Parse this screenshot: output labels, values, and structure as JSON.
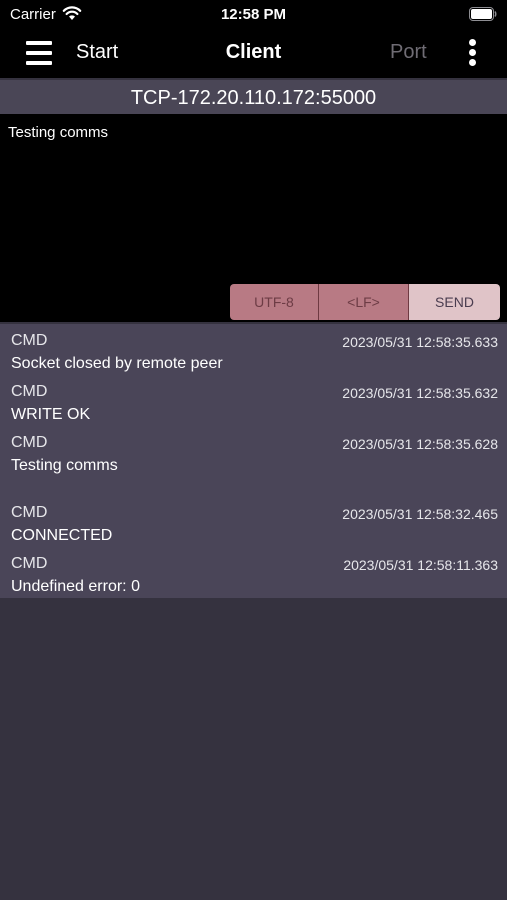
{
  "status_bar": {
    "carrier": "Carrier",
    "time": "12:58 PM"
  },
  "nav": {
    "start_label": "Start",
    "title": "Client",
    "port_label": "Port"
  },
  "connection": {
    "label": "TCP-172.20.110.172:55000"
  },
  "input": {
    "text": "Testing comms"
  },
  "buttons": {
    "encoding": "UTF-8",
    "line_ending": "<LF>",
    "send": "SEND"
  },
  "log": [
    {
      "type": "CMD",
      "time": "2023/05/31 12:58:35.633",
      "message": "Socket closed by remote peer"
    },
    {
      "type": "CMD",
      "time": "2023/05/31 12:58:35.632",
      "message": "WRITE OK"
    },
    {
      "type": "CMD",
      "time": "2023/05/31 12:58:35.628",
      "message": "Testing comms"
    },
    {
      "type": "CMD",
      "time": "2023/05/31 12:58:32.465",
      "message": "CONNECTED"
    },
    {
      "type": "CMD",
      "time": "2023/05/31 12:58:11.363",
      "message": "Undefined error: 0"
    }
  ],
  "colors": {
    "background": "#35323f",
    "log_background": "#4a4558",
    "header_background": "#4a4656",
    "button_accent": "#b87a84",
    "send_button": "#e0c4c8"
  },
  "icons": {
    "menu": "hamburger-menu-icon",
    "more": "vertical-ellipsis-icon",
    "wifi": "wifi-icon",
    "battery": "battery-icon"
  }
}
